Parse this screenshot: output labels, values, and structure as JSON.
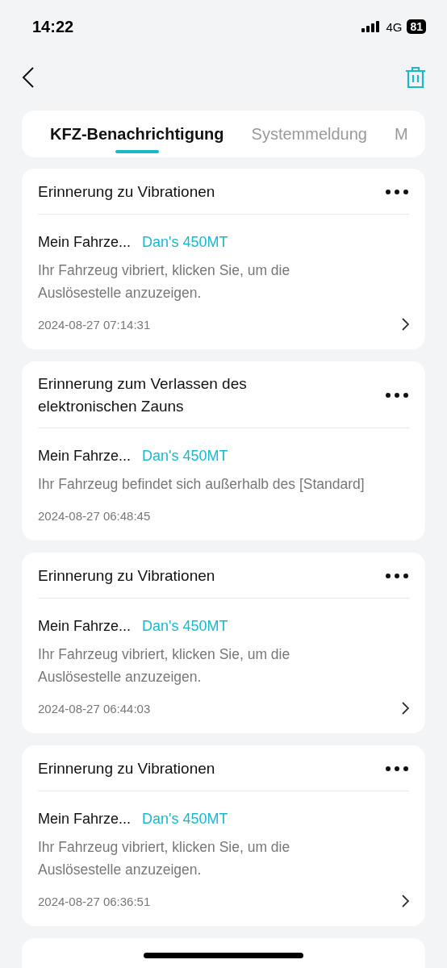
{
  "status_bar": {
    "time": "14:22",
    "network": "4G",
    "battery": "81"
  },
  "tabs": [
    {
      "label": "KFZ-Benachrichtigung",
      "selected": true
    },
    {
      "label": "Systemmeldung",
      "selected": false
    },
    {
      "label": "M",
      "selected": false
    }
  ],
  "notifications": [
    {
      "title": "Erinnerung zu Vibrationen",
      "vehicle_label": "Mein Fahrze...",
      "vehicle": "Dan's 450MT",
      "message": "Ihr Fahrzeug vibriert, klicken Sie, um die Auslösestelle anzuzeigen.",
      "time": "2024-08-27 07:14:31",
      "has_arrow": true
    },
    {
      "title": "Erinnerung zum Verlassen des elektronischen Zauns",
      "vehicle_label": "Mein Fahrze...",
      "vehicle": "Dan's 450MT",
      "message": "Ihr Fahrzeug befindet sich außerhalb des [Standard]",
      "time": "2024-08-27 06:48:45",
      "has_arrow": false
    },
    {
      "title": "Erinnerung zu Vibrationen",
      "vehicle_label": "Mein Fahrze...",
      "vehicle": "Dan's 450MT",
      "message": "Ihr Fahrzeug vibriert, klicken Sie, um die Auslösestelle anzuzeigen.",
      "time": "2024-08-27 06:44:03",
      "has_arrow": true
    },
    {
      "title": "Erinnerung zu Vibrationen",
      "vehicle_label": "Mein Fahrze...",
      "vehicle": "Dan's 450MT",
      "message": "Ihr Fahrzeug vibriert, klicken Sie, um die Auslösestelle anzuzeigen.",
      "time": "2024-08-27 06:36:51",
      "has_arrow": true
    }
  ],
  "more_below": true
}
